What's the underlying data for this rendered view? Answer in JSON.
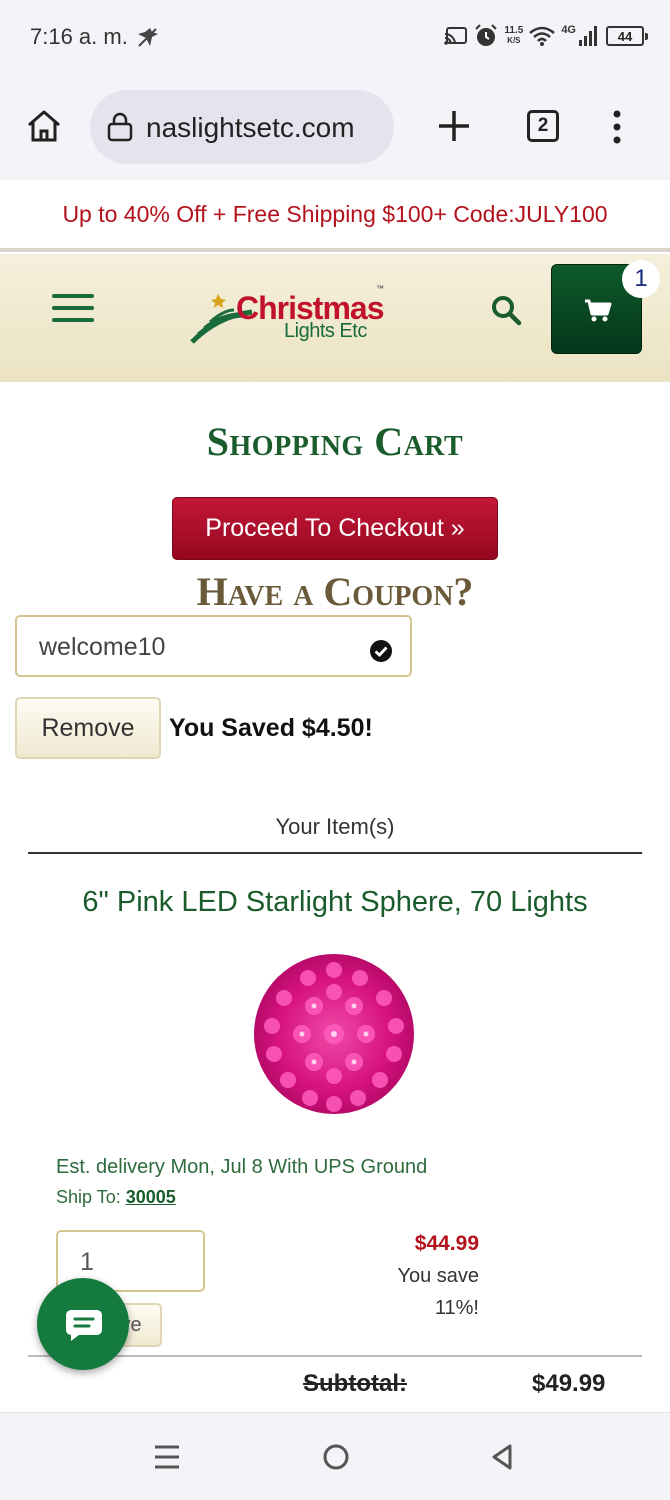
{
  "status_bar": {
    "time": "7:16 a. m.",
    "net_speed_top": "11.5",
    "net_speed_unit": "K/S",
    "network_type": "4G",
    "battery": "44"
  },
  "browser": {
    "url": "naslightsetc.com",
    "tab_count": "2"
  },
  "promo": {
    "text": "Up to 40% Off + Free Shipping $100+ Code:JULY100"
  },
  "header": {
    "logo_line1": "Christmas",
    "logo_line2": "Lights Etc",
    "logo_tm": "™",
    "cart_count": "1"
  },
  "cart": {
    "title": "Shopping Cart",
    "checkout_label": "Proceed To Checkout »",
    "coupon_heading": "Have a Coupon?",
    "coupon_value": "welcome10",
    "remove_label": "Remove",
    "saved_text": "You Saved $4.50!",
    "items_heading": "Your Item(s)"
  },
  "item": {
    "name": "6\" Pink LED Starlight Sphere, 70 Lights",
    "delivery": "Est. delivery Mon, Jul 8 With UPS Ground",
    "ship_to_label": "Ship To:",
    "ship_to_zip": "30005",
    "quantity": "1",
    "remove_label_partial": "ve",
    "price": "$44.99",
    "you_save_line1": "You save",
    "you_save_line2": "11%!"
  },
  "totals": {
    "subtotal_label": "Subtotal:",
    "subtotal_value": "$49.99"
  },
  "colors": {
    "brand_green": "#1a5c2c",
    "brand_red": "#b3121d",
    "cart_button": "#0d5a2a",
    "chat_button": "#157a3e"
  },
  "icons": {
    "home": "home-icon",
    "lock": "lock-icon",
    "plus": "new-tab-icon",
    "menu": "more-vert-icon",
    "search": "search-icon",
    "cart": "cart-icon",
    "check": "check-circle-icon",
    "chat": "chat-icon"
  }
}
